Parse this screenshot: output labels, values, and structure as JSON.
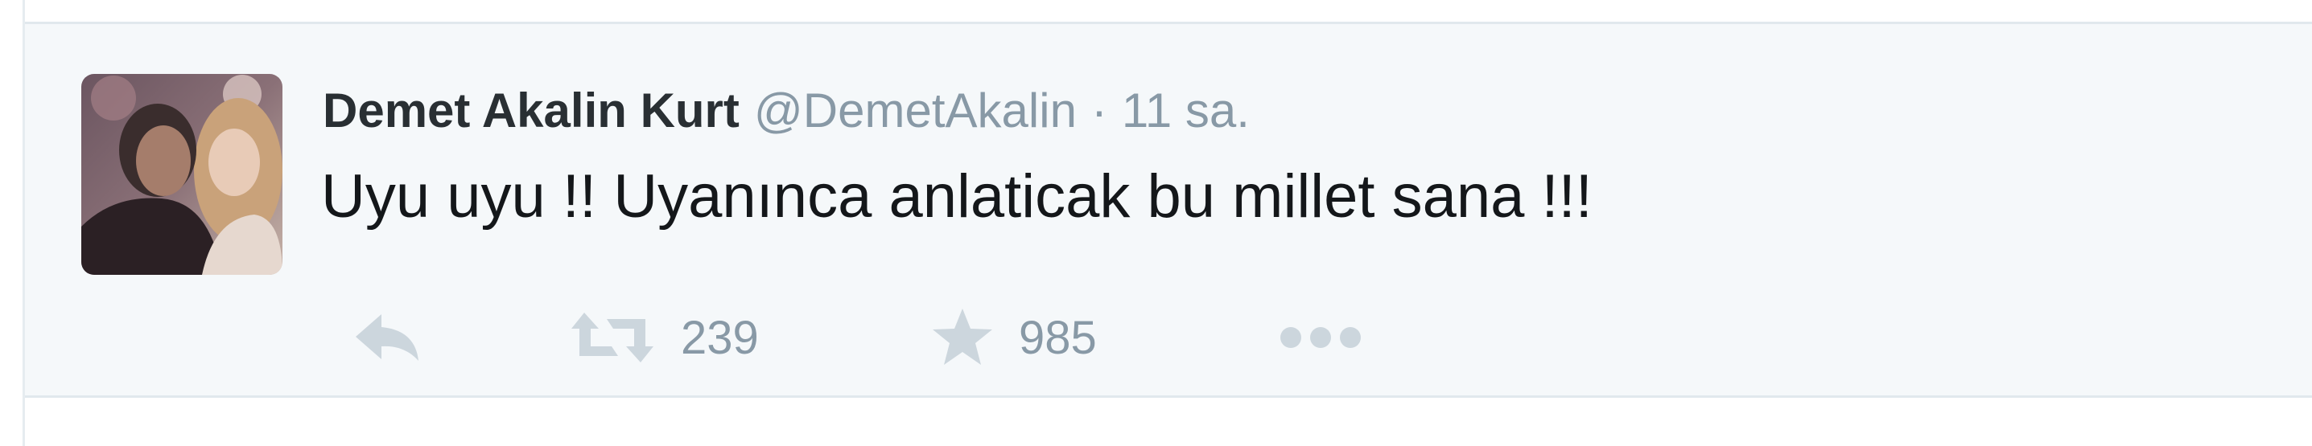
{
  "tweet": {
    "author_name": "Demet Akalin Kurt",
    "author_handle": "@DemetAkalin",
    "separator": "·",
    "timestamp": "11 sa.",
    "text": "Uyu uyu !! Uyanınca anlaticak bu millet sana !!!",
    "actions": {
      "reply_icon": "reply-icon",
      "retweet_icon": "retweet-icon",
      "retweet_count": "239",
      "favorite_icon": "star-icon",
      "favorite_count": "985",
      "more_icon": "more-dots-icon"
    }
  },
  "colors": {
    "background": "#f5f8fa",
    "name": "#292f33",
    "muted": "#8899a6",
    "icon": "#ccd6dd",
    "text": "#14171a"
  }
}
